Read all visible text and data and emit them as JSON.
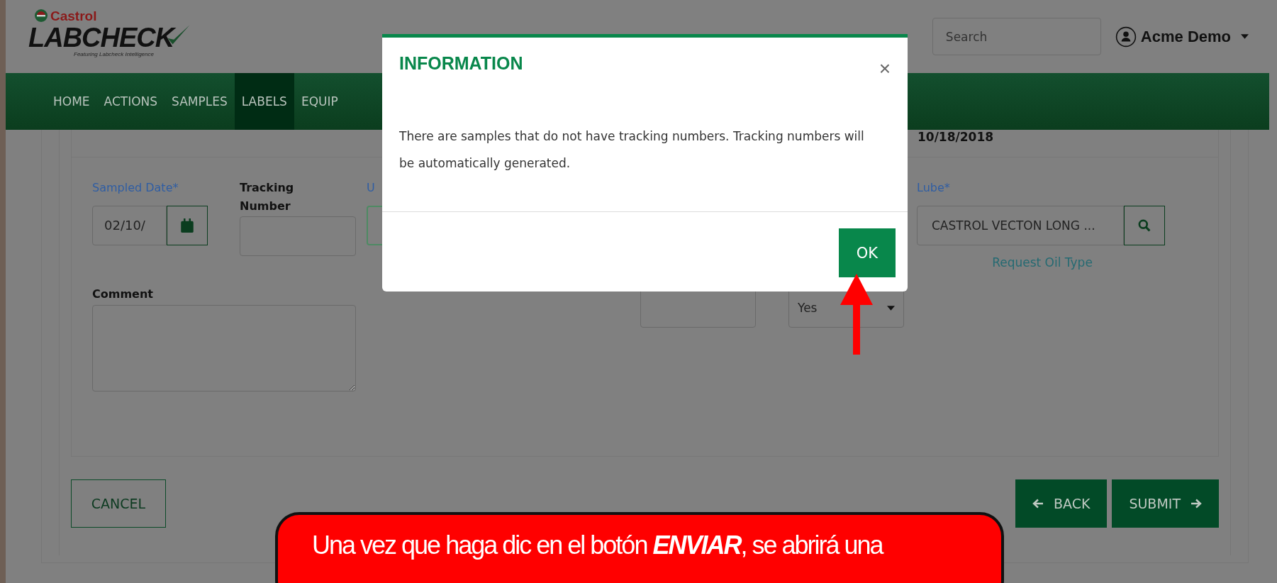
{
  "header": {
    "logo": {
      "brand": "Castrol",
      "product": "LABCHECK",
      "tagline": "Featuring Labcheck Intelligence"
    },
    "search": {
      "placeholder": "Search"
    },
    "user": {
      "name": "Acme Demo"
    }
  },
  "nav": [
    {
      "label": "HOME",
      "selected": false
    },
    {
      "label": "ACTIONS",
      "selected": false
    },
    {
      "label": "SAMPLES",
      "selected": false
    },
    {
      "label": "LABELS",
      "selected": true
    },
    {
      "label": "EQUIP",
      "selected": false
    }
  ],
  "card": {
    "header_date": "10/18/2018",
    "sampled_date": {
      "label": "Sampled Date*",
      "value": "02/10/"
    },
    "tracking_number": {
      "label": "Tracking Number"
    },
    "column_3": {
      "label": "U"
    },
    "lube": {
      "label": "Lube*",
      "value": "CASTROL VECTON LONG ...",
      "link": "Request Oil Type"
    },
    "select": {
      "value": "Yes"
    },
    "comment": {
      "label": "Comment"
    }
  },
  "buttons": {
    "cancel": "CANCEL",
    "back": "BACK",
    "submit": "SUBMIT"
  },
  "modal": {
    "title": "INFORMATION",
    "close": "×",
    "message": "There are samples that do not have tracking numbers. Tracking numbers will be automatically generated.",
    "ok": "OK"
  },
  "callout": {
    "text": "Una vez que haga dic en el botón **ENVIAR**, se abrirá una"
  }
}
